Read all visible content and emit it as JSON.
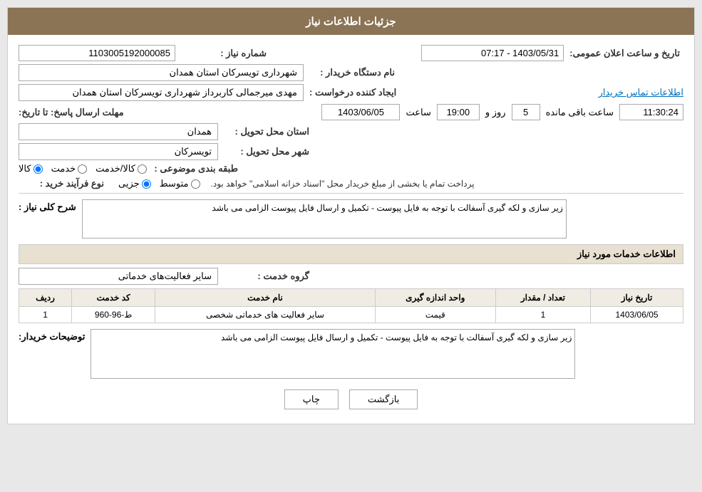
{
  "header": {
    "title": "جزئیات اطلاعات نیاز"
  },
  "need_number": {
    "label": "شماره نیاز :",
    "value": "1103005192000085"
  },
  "announcement_datetime": {
    "label": "تاریخ و ساعت اعلان عمومی:",
    "value": "1403/05/31 - 07:17"
  },
  "buyer_org": {
    "label": "نام دستگاه خریدار :",
    "value": "شهرداری تویسرکان استان همدان"
  },
  "creator": {
    "label": "ایجاد کننده درخواست :",
    "value": "مهدی میرجمالی کاربرداز شهرداری تویسرکان استان همدان",
    "link_text": "اطلاعات تماس خریدار"
  },
  "response_deadline": {
    "label": "مهلت ارسال پاسخ: تا تاریخ:",
    "date_value": "1403/06/05",
    "time_label": "ساعت",
    "time_value": "19:00",
    "day_label": "روز و",
    "day_value": "5",
    "remaining_label": "ساعت باقی مانده",
    "remaining_value": "11:30:24"
  },
  "province": {
    "label": "استان محل تحویل :",
    "value": "همدان"
  },
  "city": {
    "label": "شهر محل تحویل :",
    "value": "تویسرکان"
  },
  "category": {
    "label": "طبقه بندی موضوعی :",
    "options": [
      "کالا",
      "خدمت",
      "کالا/خدمت"
    ],
    "selected": "کالا"
  },
  "purchase_type": {
    "label": "نوع فرآیند خرید :",
    "options": [
      "جزیی",
      "متوسط"
    ],
    "description": "پرداخت تمام یا بخشی از مبلغ خریدار محل \"اسناد خزانه اسلامی\" خواهد بود."
  },
  "description": {
    "label": "شرح کلی نیاز :",
    "value": "زیر سازی و لکه گیری آسفالت با توجه به فایل پیوست - تکمیل و ارسال فایل پیوست الزامی می باشد"
  },
  "services_section": {
    "header": "اطلاعات خدمات مورد نیاز",
    "group_label": "گروه خدمت :",
    "group_value": "سایر فعالیت‌های خدماتی",
    "table": {
      "columns": [
        "ردیف",
        "کد خدمت",
        "نام خدمت",
        "واحد اندازه گیری",
        "تعداد / مقدار",
        "تاریخ نیاز"
      ],
      "rows": [
        {
          "row_num": "1",
          "code": "ط-96-960",
          "name": "سایر فعالیت های خدماتی شخصی",
          "unit": "قیمت",
          "quantity": "1",
          "date": "1403/06/05"
        }
      ]
    }
  },
  "buyer_desc": {
    "label": "توضیحات خریدار:",
    "value": "زیر سازی و لکه گیری آسفالت با توجه به فایل پیوست - تکمیل و ارسال فایل پیوست الزامی می باشد"
  },
  "buttons": {
    "print": "چاپ",
    "back": "بازگشت"
  }
}
